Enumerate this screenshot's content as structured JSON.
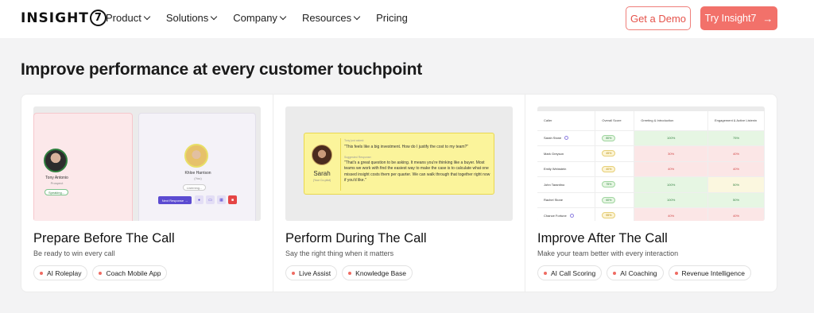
{
  "nav": {
    "logo_text": "INSIGHT",
    "logo_mark": "7",
    "menu": [
      {
        "label": "Product",
        "has_dropdown": true
      },
      {
        "label": "Solutions",
        "has_dropdown": true
      },
      {
        "label": "Company",
        "has_dropdown": true
      },
      {
        "label": "Resources",
        "has_dropdown": true
      },
      {
        "label": "Pricing",
        "has_dropdown": false
      }
    ],
    "demo_label": "Get a Demo",
    "try_label": "Try Insight7",
    "try_icon": "arrow-right-icon"
  },
  "section": {
    "title": "Improve performance at every customer touchpoint"
  },
  "cards": [
    {
      "title": "Prepare Before The Call",
      "subtitle": "Be ready to win every call",
      "tags": [
        "AI Roleplay",
        "Coach Mobile App"
      ],
      "visual": {
        "left_name": "Tony Antonio",
        "left_role": "Prospect",
        "left_status": "Speaking...",
        "right_name": "Khloe Harrison",
        "right_role": "(You)",
        "right_status": "Listening...",
        "next_button": "Next Response →"
      }
    },
    {
      "title": "Perform During The Call",
      "subtitle": "Say the right thing when it matters",
      "tags": [
        "Live Assist",
        "Knowledge Base"
      ],
      "visual": {
        "name": "Sarah",
        "role": "(Your Co-pilot)",
        "question_label": "Tony just asked:",
        "question": "\"This feels like a big investment. How do I justify the cost to my team?\"",
        "answer_label": "Suggested Response:",
        "answer": "\"That's a great question to be asking. It means you're thinking like a buyer. Most teams we work with find the easiest way to make the case is to calculate what one missed insight costs them per quarter. We can walk through that together right now if you'd like.\""
      }
    },
    {
      "title": "Improve After The Call",
      "subtitle": "Make your team better with every interaction",
      "tags": [
        "AI Call Scoring",
        "AI Coaching",
        "Revenue Intelligence"
      ],
      "visual": {
        "headers": [
          "Caller",
          "Overall Score",
          "Greeting & Introduction",
          "Engagement & Active Listenin"
        ],
        "rows": [
          {
            "caller": "Sarah Stone",
            "score": "80%",
            "greeting": "100%",
            "engagement": "75%",
            "g_status": "good",
            "e_status": "good",
            "badge": "green"
          },
          {
            "caller": "Mark Greyson",
            "score": "45%",
            "greeting": "30%",
            "engagement": "40%",
            "g_status": "bad",
            "e_status": "bad",
            "badge": "yellow"
          },
          {
            "caller": "Emily Weinstein",
            "score": "40%",
            "greeting": "40%",
            "engagement": "40%",
            "g_status": "bad",
            "e_status": "bad",
            "badge": "yellow"
          },
          {
            "caller": "John Tarantino",
            "score": "75%",
            "greeting": "100%",
            "engagement": "50%",
            "g_status": "good",
            "e_status": "mid",
            "badge": "green"
          },
          {
            "caller": "Rachel Stone",
            "score": "60%",
            "greeting": "100%",
            "engagement": "50%",
            "g_status": "good",
            "e_status": "good",
            "badge": "green"
          },
          {
            "caller": "Chance Fortune",
            "score": "55%",
            "greeting": "40%",
            "engagement": "40%",
            "g_status": "bad",
            "e_status": "bad",
            "badge": "yellow"
          }
        ]
      }
    }
  ],
  "colors": {
    "accent": "#f2716a",
    "accent_text": "#e5534b",
    "background": "#f3f3f4"
  }
}
